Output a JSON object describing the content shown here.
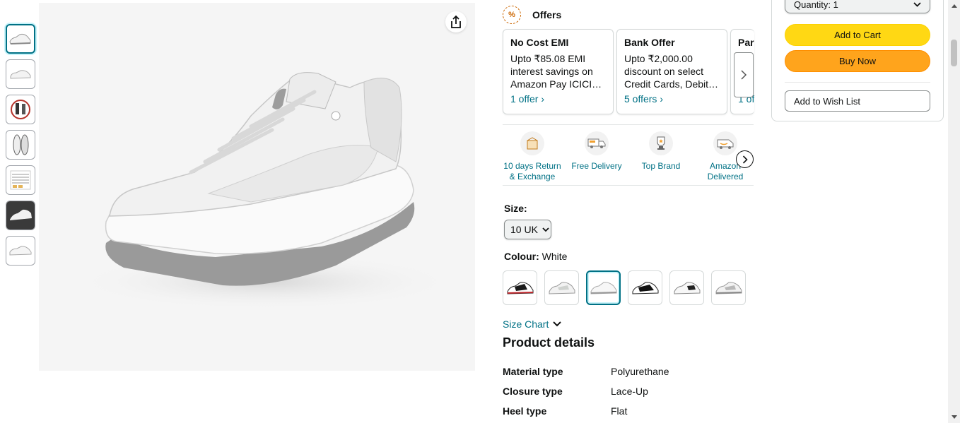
{
  "thumbnails": [
    {
      "name": "thumb-shoe-side",
      "active": true
    },
    {
      "name": "thumb-shoe-pair"
    },
    {
      "name": "thumb-lifestyle"
    },
    {
      "name": "thumb-sole"
    },
    {
      "name": "thumb-size-chart"
    },
    {
      "name": "thumb-shoe-dark"
    },
    {
      "name": "thumb-shoe-angle"
    }
  ],
  "offers": {
    "title": "Offers",
    "icon_text": "%",
    "cards": [
      {
        "title": "No Cost EMI",
        "desc": "Upto ₹85.08 EMI interest savings on Amazon Pay ICICI…",
        "link": "1 offer ›"
      },
      {
        "title": "Bank Offer",
        "desc": "Upto ₹2,000.00 discount on select Credit Cards, Debit…",
        "link": "5 offers ›"
      },
      {
        "title": "Par",
        "desc": "",
        "link": "1 of"
      }
    ]
  },
  "features": [
    {
      "label": "10 days Return & Exchange",
      "icon": "return-box-icon"
    },
    {
      "label": "Free Delivery",
      "icon": "delivery-truck-icon"
    },
    {
      "label": "Top Brand",
      "icon": "trophy-icon"
    },
    {
      "label": "Amazon Delivered",
      "icon": "amazon-van-icon"
    }
  ],
  "size": {
    "label": "Size:",
    "selected": "10 UK"
  },
  "colour": {
    "label": "Colour:",
    "value": "White"
  },
  "size_chart": "Size Chart",
  "product_details": {
    "title": "Product details",
    "rows": [
      {
        "key": "Material type",
        "value": "Polyurethane"
      },
      {
        "key": "Closure type",
        "value": "Lace-Up"
      },
      {
        "key": "Heel type",
        "value": "Flat"
      }
    ]
  },
  "buybox": {
    "quantity": "Quantity: 1",
    "add_to_cart": "Add to Cart",
    "buy_now": "Buy Now",
    "add_to_wishlist": "Add to Wish List"
  },
  "colors": {
    "accent_link": "#007185",
    "cart_yellow": "#ffd814",
    "buy_orange": "#ffa41c"
  }
}
